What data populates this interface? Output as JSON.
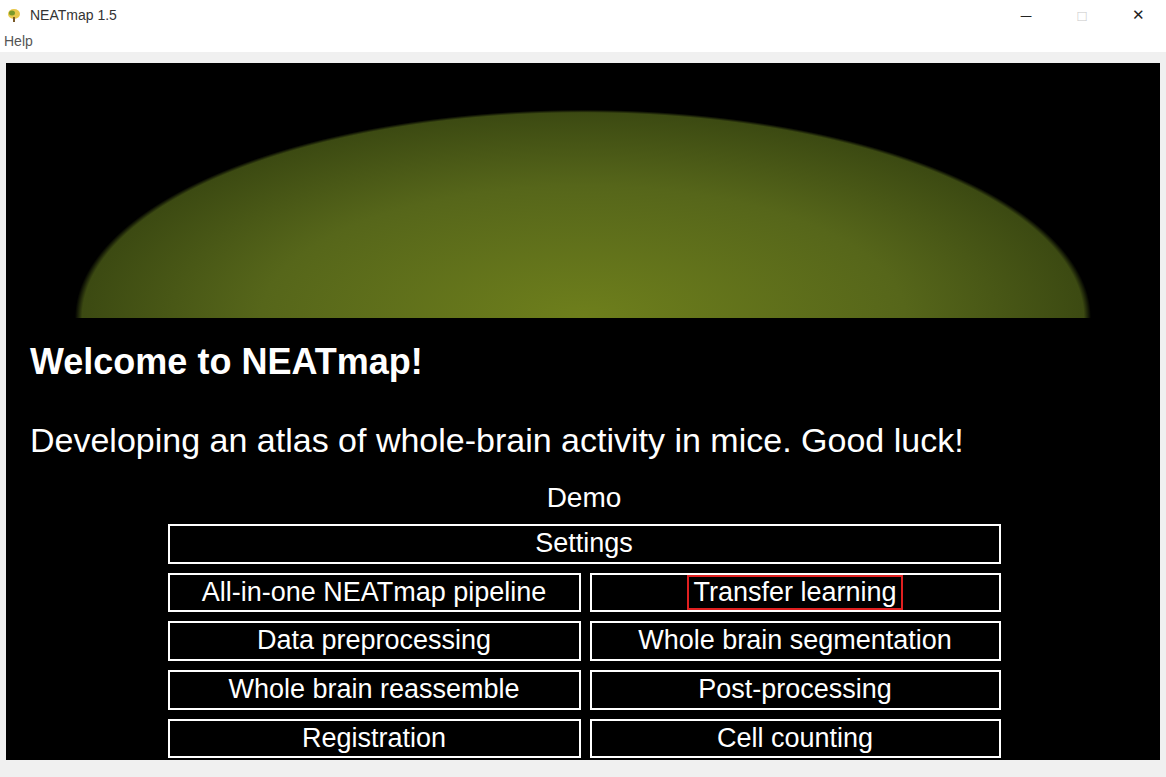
{
  "window": {
    "title": "NEATmap 1.5",
    "controls": [
      {
        "label": "─",
        "disabled": false
      },
      {
        "label": "□",
        "disabled": true
      },
      {
        "label": "✕",
        "disabled": false
      }
    ]
  },
  "menu": [
    {
      "label": "Help"
    }
  ],
  "welcome": {
    "heading": "Welcome to NEATmap!",
    "subtitle": "Developing an atlas of whole-brain activity in mice. Good luck!"
  },
  "demo": {
    "label": "Demo"
  },
  "settings_button": {
    "label": "Settings",
    "highlighted": false
  },
  "buttons": [
    {
      "label": "All-in-one NEATmap pipeline",
      "highlighted": false
    },
    {
      "label": "Transfer learning",
      "highlighted": true
    },
    {
      "label": "Data preprocessing",
      "highlighted": false
    },
    {
      "label": "Whole brain segmentation",
      "highlighted": false
    },
    {
      "label": "Whole brain reassemble",
      "highlighted": false
    },
    {
      "label": "Post-processing",
      "highlighted": false
    },
    {
      "label": "Registration",
      "highlighted": false
    },
    {
      "label": "Cell counting",
      "highlighted": false
    }
  ]
}
